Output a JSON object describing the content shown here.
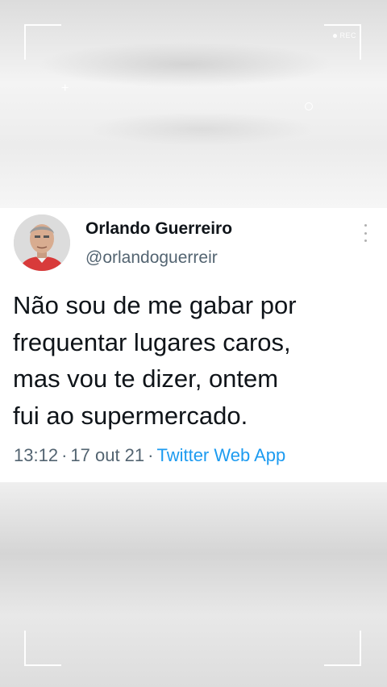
{
  "overlay": {
    "rec_label": "REC"
  },
  "tweet": {
    "author_name": "Orlando Guerreiro",
    "author_handle": "@orlandoguerreir",
    "text_lines": [
      "Não sou de me gabar por",
      "frequentar lugares caros,",
      "mas vou te dizer, ontem",
      "fui ao supermercado."
    ],
    "time": "13:12",
    "date": "17 out 21",
    "separator": "·",
    "source": "Twitter Web App"
  },
  "colors": {
    "name": "#0f1419",
    "secondary": "#536471",
    "link": "#1d9bf0",
    "shirt": "#d83a3a"
  },
  "icons": {
    "more": "more-vertical-icon",
    "rec_dot": "record-dot-icon"
  }
}
